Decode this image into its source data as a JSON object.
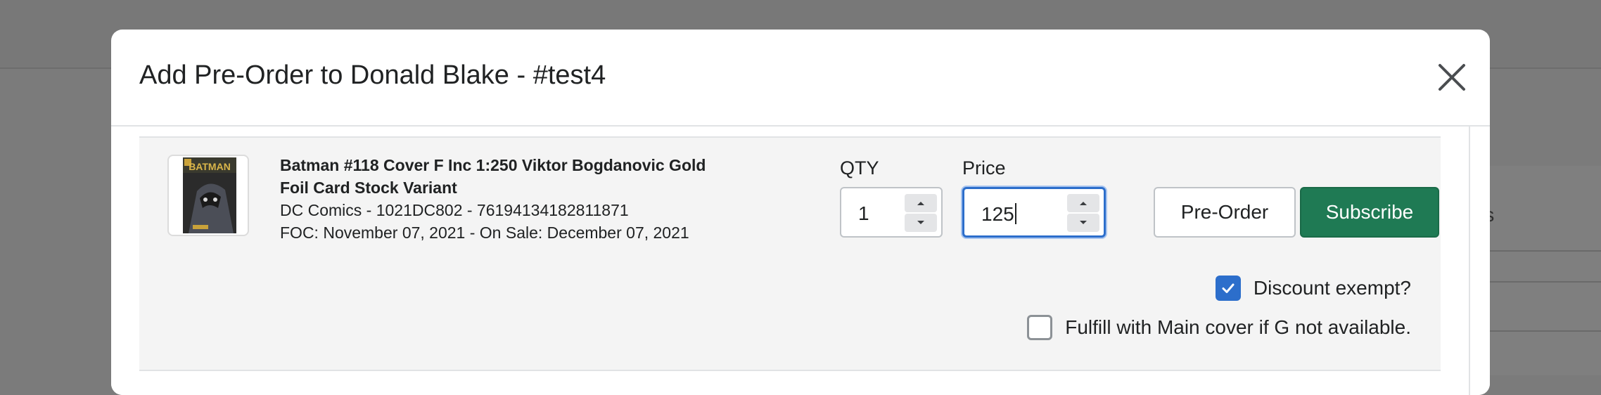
{
  "background": {
    "right_panel_fragment": "mers"
  },
  "modal": {
    "title": "Add Pre-Order to Donald Blake - #test4",
    "close_icon": "close-icon"
  },
  "product": {
    "thumbnail_alt": "Batman #118 cover",
    "thumbnail_text": "BATMAN",
    "title_line1": "Batman #118 Cover F Inc 1:250 Viktor Bogdanovic Gold",
    "title_line2": "Foil Card Stock Variant",
    "publisher_line": "DC Comics - 1021DC802 - 76194134182811871",
    "dates_line": "FOC: November 07, 2021 -  On Sale: December 07, 2021"
  },
  "qty": {
    "label": "QTY",
    "value": "1"
  },
  "price": {
    "label": "Price",
    "value": "125"
  },
  "actions": {
    "preorder_label": "Pre-Order",
    "subscribe_label": "Subscribe"
  },
  "options": {
    "discount_exempt_label": "Discount exempt?",
    "discount_exempt_checked": true,
    "fulfill_main_label": "Fulfill with Main cover if G not available.",
    "fulfill_main_checked": false
  },
  "colors": {
    "primary_button": "#1f7a54",
    "focus_ring": "#2c6ecb",
    "checkbox_checked": "#2c6ecb",
    "overlay": "#7b7b7b"
  }
}
